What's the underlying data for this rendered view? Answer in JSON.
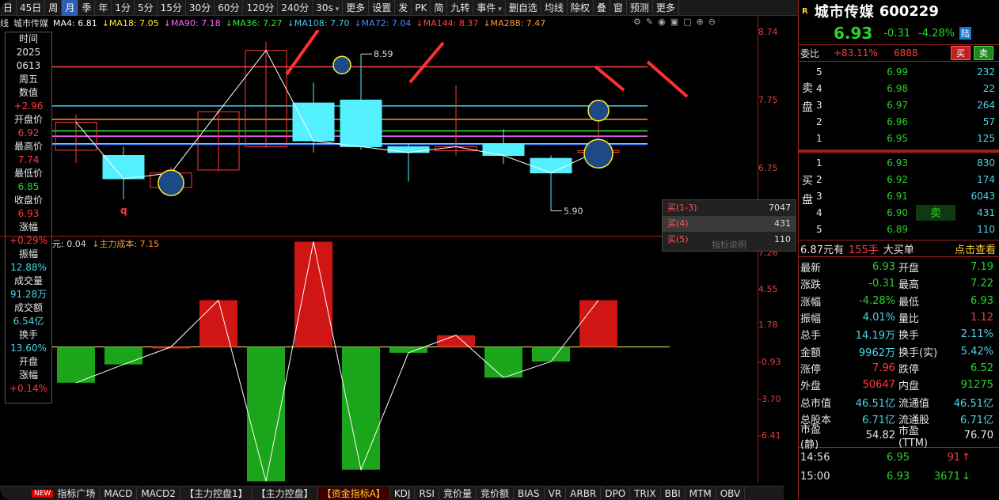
{
  "toolbar": {
    "items": [
      "日",
      "45日",
      "周",
      "月",
      "季",
      "年",
      "1分",
      "5分",
      "15分",
      "30分",
      "60分",
      "120分",
      "240分",
      "30s",
      "更多",
      "设置",
      "发",
      "PK",
      "简",
      "九转",
      "事件",
      "删自选",
      "均线",
      "除权",
      "叠",
      "窗",
      "预测",
      "更多"
    ],
    "active": "月"
  },
  "ma_header": {
    "prefix": "线",
    "stock": "城市传媒",
    "items": [
      {
        "label": "MA4: 6.81",
        "color": "#ffffff"
      },
      {
        "label": "↓MA18: 7.05",
        "color": "#ffee33"
      },
      {
        "label": "↓MA90: 7.18",
        "color": "#ff66ff"
      },
      {
        "label": "↓MA36: 7.27",
        "color": "#33ee33"
      },
      {
        "label": "↓MA108: 7.70",
        "color": "#44ccee"
      },
      {
        "label": "↓MA72: 7.04",
        "color": "#4488ff"
      },
      {
        "label": "↓MA144: 8.37",
        "color": "#ff4444"
      },
      {
        "label": "↓MA288: 7.47",
        "color": "#ff9933"
      }
    ]
  },
  "left_panel": [
    {
      "label": "时间",
      "value": "2025",
      "color": "#e6e6e6"
    },
    {
      "label": "",
      "value": "0613",
      "color": "#e6e6e6"
    },
    {
      "label": "周五",
      "value": "",
      "color": "#e6e6e6"
    },
    {
      "label": "数值",
      "value": "+2.96",
      "color": "#ff3b3b"
    },
    {
      "label": "开盘价",
      "value": "6.92",
      "color": "#ff3b3b"
    },
    {
      "label": "最高价",
      "value": "7.74",
      "color": "#ff3b3b"
    },
    {
      "label": "最低价",
      "value": "6.85",
      "color": "#2ad22a"
    },
    {
      "label": "收盘价",
      "value": "6.93",
      "color": "#ff3b3b"
    },
    {
      "label": "涨幅",
      "value": "+0.29%",
      "color": "#ff3b3b"
    },
    {
      "label": "振幅",
      "value": "12.88%",
      "color": "#4fd3e8"
    },
    {
      "label": "成交量",
      "value": "91.28万",
      "color": "#4fd3e8"
    },
    {
      "label": "成交额",
      "value": "6.54亿",
      "color": "#4fd3e8"
    },
    {
      "label": "换手",
      "value": "13.60%",
      "color": "#4fd3e8"
    },
    {
      "label": "开盘",
      "value": "",
      "color": "#e6e6e6"
    },
    {
      "label": "涨幅",
      "value": "+0.14%",
      "color": "#ff3b3b"
    }
  ],
  "price_axis": [
    "8.74",
    "7.75",
    "6.75"
  ],
  "indicator_axis": [
    "7.26",
    "4.55",
    "1.78",
    "-0.93",
    "-3.70",
    "-6.41"
  ],
  "annotations": {
    "high": "8.59",
    "low": "5.90",
    "q": "q"
  },
  "indicator_header": {
    "prefix": "元: 0.04",
    "cost": "↓主力成本: 7.15"
  },
  "chart_data": {
    "type": "candlestick",
    "ylim": [
      5.5,
      9.0
    ],
    "candles": [
      {
        "o": 6.94,
        "c": 7.42,
        "h": 7.55,
        "l": 6.72
      },
      {
        "o": 6.85,
        "c": 6.45,
        "h": 7.0,
        "l": 6.1
      },
      {
        "o": 6.3,
        "c": 6.55,
        "h": 6.65,
        "l": 6.25
      },
      {
        "o": 6.6,
        "c": 7.6,
        "h": 7.65,
        "l": 6.58
      },
      {
        "o": 7.0,
        "c": 8.65,
        "h": 8.8,
        "l": 6.98
      },
      {
        "o": 7.75,
        "c": 7.1,
        "h": 8.1,
        "l": 6.9
      },
      {
        "o": 7.8,
        "c": 7.0,
        "h": 8.59,
        "l": 6.95
      },
      {
        "o": 7.0,
        "c": 6.9,
        "h": 7.05,
        "l": 6.4
      },
      {
        "o": 6.93,
        "c": 7.0,
        "h": 8.05,
        "l": 6.85
      },
      {
        "o": 7.05,
        "c": 6.85,
        "h": 7.3,
        "l": 6.7
      },
      {
        "o": 6.8,
        "c": 6.55,
        "h": 6.85,
        "l": 5.9
      },
      {
        "o": 6.92,
        "c": 6.93,
        "h": 7.74,
        "l": 6.85
      }
    ],
    "indicator_values": [
      -2.45,
      -1.2,
      0.0,
      3.2,
      -9.2,
      7.2,
      -8.4,
      -0.4,
      0.8,
      -2.1,
      -1.0,
      3.2
    ]
  },
  "tooltip": {
    "rows": [
      {
        "label": "买(1-3)",
        "value": "7047"
      },
      {
        "label": "买(4)",
        "value": "431"
      },
      {
        "label": "买(5)",
        "value": "110"
      }
    ],
    "hint": "指标说明"
  },
  "bottom_tabs": {
    "new": "NEW",
    "items": [
      "指标广场",
      "MACD",
      "MACD2",
      "【主力控盘1】",
      "【主力控盘】",
      "【资金指标A】",
      "KDJ",
      "RSI",
      "竞价量",
      "竞价额",
      "BIAS",
      "VR",
      "ARBR",
      "DPO",
      "TRIX",
      "BBI",
      "MTM",
      "OBV"
    ],
    "active": "【资金指标A】"
  },
  "right": {
    "tag": "R",
    "name": "城市传媒",
    "code": "600229",
    "price": "6.93",
    "change": "-0.31",
    "pct": "-4.28%",
    "lu": "陆",
    "weibi_label": "委比",
    "weibi_pct": "+83.11%",
    "weibi_val": "6888",
    "buy_btn": "买",
    "sell_btn": "卖",
    "sell_side_label": [
      "卖",
      "盘"
    ],
    "buy_side_label": [
      "买",
      "盘"
    ],
    "asks": [
      {
        "lvl": "5",
        "price": "6.99",
        "vol": "232"
      },
      {
        "lvl": "4",
        "price": "6.98",
        "vol": "22"
      },
      {
        "lvl": "3",
        "price": "6.97",
        "vol": "264"
      },
      {
        "lvl": "2",
        "price": "6.96",
        "vol": "57"
      },
      {
        "lvl": "1",
        "price": "6.95",
        "vol": "125"
      }
    ],
    "bids": [
      {
        "lvl": "1",
        "price": "6.93",
        "vol": "830"
      },
      {
        "lvl": "2",
        "price": "6.92",
        "vol": "174"
      },
      {
        "lvl": "3",
        "price": "6.91",
        "vol": "6043"
      },
      {
        "lvl": "4",
        "price": "6.90",
        "vol": "431",
        "tag": "卖"
      },
      {
        "lvl": "5",
        "price": "6.89",
        "vol": "110"
      }
    ],
    "bigorder": {
      "price": "6.87元有",
      "qty": "155手",
      "label": "大买单",
      "link": "点击查看"
    },
    "stats": [
      {
        "k": "最新",
        "v": "6.93",
        "vc": "#2ad22a",
        "k2": "开盘",
        "v2": "7.19",
        "v2c": "#2ad22a"
      },
      {
        "k": "涨跌",
        "v": "-0.31",
        "vc": "#2ad22a",
        "k2": "最高",
        "v2": "7.22",
        "v2c": "#2ad22a"
      },
      {
        "k": "涨幅",
        "v": "-4.28%",
        "vc": "#2ad22a",
        "k2": "最低",
        "v2": "6.93",
        "v2c": "#2ad22a"
      },
      {
        "k": "振幅",
        "v": "4.01%",
        "vc": "#4fd3e8",
        "k2": "量比",
        "v2": "1.12",
        "v2c": "#ff3b3b"
      },
      {
        "k": "总手",
        "v": "14.19万",
        "vc": "#4fd3e8",
        "k2": "换手",
        "v2": "2.11%",
        "v2c": "#4fd3e8"
      },
      {
        "k": "金额",
        "v": "9962万",
        "vc": "#4fd3e8",
        "k2": "换手(实)",
        "v2": "5.42%",
        "v2c": "#4fd3e8"
      },
      {
        "k": "涨停",
        "v": "7.96",
        "vc": "#ff3b3b",
        "k2": "跌停",
        "v2": "6.52",
        "v2c": "#2ad22a"
      },
      {
        "k": "外盘",
        "v": "50647",
        "vc": "#ff3b3b",
        "k2": "内盘",
        "v2": "91275",
        "v2c": "#2ad22a"
      },
      {
        "k": "总市值",
        "v": "46.51亿",
        "vc": "#4fd3e8",
        "k2": "流通值",
        "v2": "46.51亿",
        "v2c": "#4fd3e8"
      },
      {
        "k": "总股本",
        "v": "6.71亿",
        "vc": "#4fd3e8",
        "k2": "流通股",
        "v2": "6.71亿",
        "v2c": "#4fd3e8"
      },
      {
        "k": "市盈(静)",
        "v": "54.82",
        "vc": "#e6e6e6",
        "k2": "市盈(TTM)",
        "v2": "76.70",
        "v2c": "#e6e6e6"
      }
    ],
    "ticks": [
      {
        "time": "14:56",
        "price": "6.95",
        "vol": "91",
        "dir": "up"
      },
      {
        "time": "15:00",
        "price": "6.93",
        "vol": "3671",
        "dir": "down"
      }
    ]
  }
}
